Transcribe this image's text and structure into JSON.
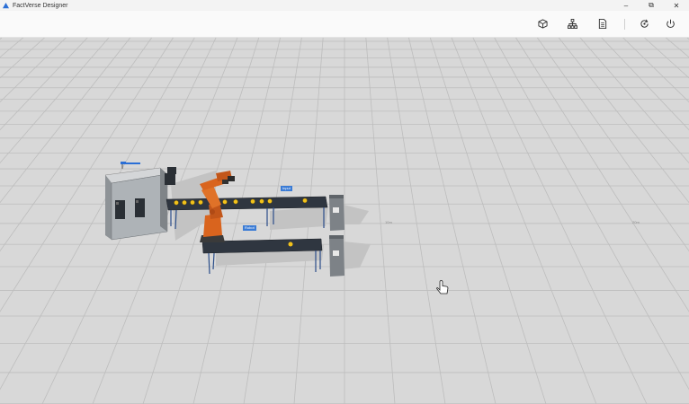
{
  "app": {
    "title": "FactVerse Designer"
  },
  "window_controls": {
    "minimize": "–",
    "maximize": "⧉",
    "close": "✕"
  },
  "toolbar": {
    "buttons": [
      {
        "name": "3d-model-button",
        "icon": "cube-icon"
      },
      {
        "name": "hierarchy-button",
        "icon": "hierarchy-icon"
      },
      {
        "name": "document-button",
        "icon": "document-icon"
      },
      {
        "name": "simulate-button",
        "icon": "refresh-icon"
      },
      {
        "name": "power-button",
        "icon": "power-icon"
      }
    ]
  },
  "scene": {
    "labels": {
      "robot": "Robot",
      "input": "Input"
    },
    "distance_labels": [
      "10m",
      "20m"
    ]
  },
  "colors": {
    "floor": "#d8d8d8",
    "grid": "#bdbdbd",
    "robot": "#d9641e",
    "conveyor": "#2f3640",
    "item": "#f2c21b",
    "label": "#3a7bd5"
  }
}
